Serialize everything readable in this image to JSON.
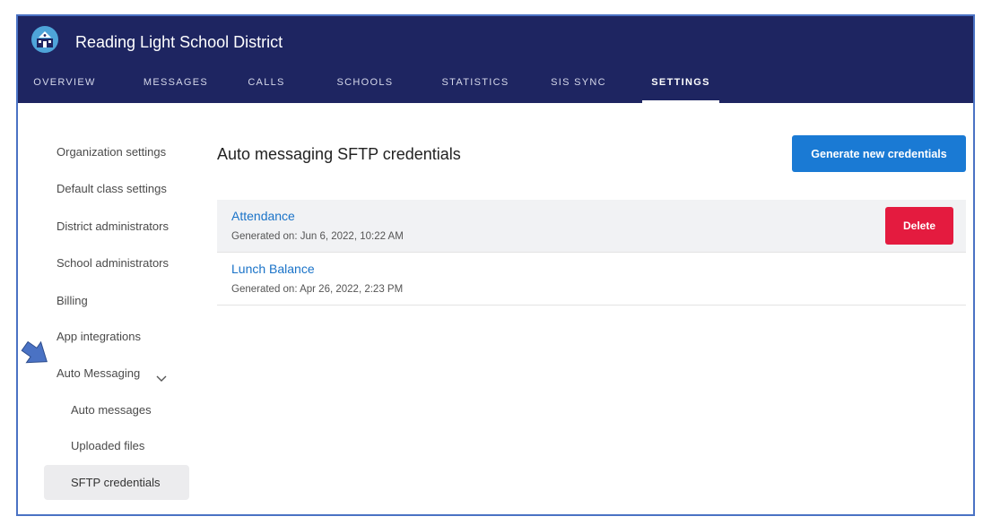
{
  "header": {
    "title": "Reading Light School District",
    "logo_icon": "school-building-icon"
  },
  "tabs": [
    {
      "label": "OVERVIEW"
    },
    {
      "label": "MESSAGES"
    },
    {
      "label": "CALLS"
    },
    {
      "label": "SCHOOLS"
    },
    {
      "label": "STATISTICS"
    },
    {
      "label": "SIS SYNC"
    },
    {
      "label": "SETTINGS",
      "active": true
    }
  ],
  "sidebar": {
    "items": [
      {
        "label": "Organization settings"
      },
      {
        "label": "Default class settings"
      },
      {
        "label": "District administrators"
      },
      {
        "label": "School administrators"
      },
      {
        "label": "Billing"
      },
      {
        "label": "App integrations"
      },
      {
        "label": "Auto Messaging",
        "expanded": true
      }
    ],
    "subitems": [
      {
        "label": "Auto messages"
      },
      {
        "label": "Uploaded files"
      },
      {
        "label": "SFTP credentials",
        "selected": true
      }
    ]
  },
  "main": {
    "title": "Auto messaging SFTP credentials",
    "generate_button": "Generate new credentials",
    "credentials": [
      {
        "name": "Attendance",
        "generated": "Generated on: Jun 6, 2022, 10:22 AM",
        "delete_label": "Delete"
      },
      {
        "name": "Lunch Balance",
        "generated": "Generated on: Apr 26, 2022, 2:23 PM"
      }
    ]
  },
  "annotation": {
    "pointer_icon": "blue-arrow-icon"
  },
  "colors": {
    "header_bg": "#1e2561",
    "primary": "#1a7ad4",
    "danger": "#e41b3f",
    "link": "#1a73c8",
    "frame_border": "#4a72c4"
  }
}
